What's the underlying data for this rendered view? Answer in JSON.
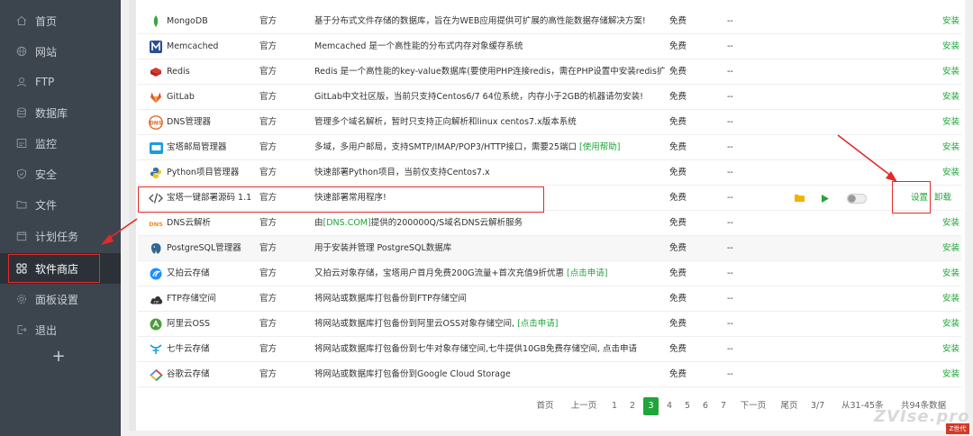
{
  "sidebar": {
    "items": [
      {
        "label": "首页",
        "icon": "home-icon"
      },
      {
        "label": "网站",
        "icon": "globe-icon"
      },
      {
        "label": "FTP",
        "icon": "ftp-icon"
      },
      {
        "label": "数据库",
        "icon": "database-icon"
      },
      {
        "label": "监控",
        "icon": "monitor-icon"
      },
      {
        "label": "安全",
        "icon": "shield-icon"
      },
      {
        "label": "文件",
        "icon": "folder-icon"
      },
      {
        "label": "计划任务",
        "icon": "calendar-icon"
      },
      {
        "label": "软件商店",
        "icon": "grid-icon",
        "active": true
      },
      {
        "label": "面板设置",
        "icon": "gear-icon"
      },
      {
        "label": "退出",
        "icon": "logout-icon"
      }
    ],
    "add_label": "+"
  },
  "plugins": [
    {
      "name": "MongoDB",
      "type": "官方",
      "desc": "基于分布式文件存储的数据库，旨在为WEB应用提供可扩展的高性能数据存储解决方案!",
      "price": "免费",
      "expire": "--",
      "action": "安装",
      "icon": "mongodb-icon",
      "icon_color": "#3aa645"
    },
    {
      "name": "Memcached",
      "type": "官方",
      "desc": "Memcached 是一个高性能的分布式内存对象缓存系统",
      "price": "免费",
      "expire": "--",
      "action": "安装",
      "icon": "memcached-icon",
      "icon_color": "#2a4f8f"
    },
    {
      "name": "Redis",
      "type": "官方",
      "desc": "Redis 是一个高性能的key-value数据库(要使用PHP连接redis，需在PHP设置中安装redis扩展)",
      "price": "免费",
      "expire": "--",
      "action": "安装",
      "icon": "redis-icon",
      "icon_color": "#c8302c"
    },
    {
      "name": "GitLab",
      "type": "官方",
      "desc": "GitLab中文社区版，当前只支持Centos6/7 64位系统，内存小于2GB的机器请勿安装!",
      "price": "免费",
      "expire": "--",
      "action": "安装",
      "icon": "gitlab-icon",
      "icon_color": "#e2572c"
    },
    {
      "name": "DNS管理器",
      "type": "官方",
      "desc": "管理多个域名解析，暂时只支持正向解析和linux centos7.x版本系统",
      "price": "免费",
      "expire": "--",
      "action": "安装",
      "icon": "dns-manager-icon",
      "icon_color": "#e36b2c"
    },
    {
      "name": "宝塔邮局管理器",
      "type": "官方",
      "desc_pre": "多域，多用户邮局，支持SMTP/IMAP/POP3/HTTP接口，需要25端口 ",
      "desc_link": "[使用帮助]",
      "price": "免费",
      "expire": "--",
      "action": "安装",
      "icon": "mail-icon",
      "icon_color": "#1e9be0"
    },
    {
      "name": "Python项目管理器",
      "type": "官方",
      "desc": "快速部署Python项目，当前仅支持Centos7.x",
      "price": "免费",
      "expire": "--",
      "action": "安装",
      "icon": "python-icon",
      "icon_color": "#3572a5"
    },
    {
      "name": "宝塔一键部署源码 1.1",
      "type": "官方",
      "desc": "快速部署常用程序!",
      "price": "免费",
      "expire": "--",
      "settings": "设置",
      "uninstall": "卸载",
      "icon": "code-icon",
      "icon_color": "#555555",
      "installed": true
    },
    {
      "name": "DNS云解析",
      "type": "官方",
      "desc_pre": "由",
      "desc_link": "[DNS.COM]",
      "desc_post": "提供的200000Q/S域名DNS云解析服务",
      "price": "免费",
      "expire": "--",
      "action": "安装",
      "icon": "dns-cloud-icon",
      "icon_color": "#f08a24"
    },
    {
      "name": "PostgreSQL管理器",
      "type": "官方",
      "desc": "用于安装并管理 PostgreSQL数据库",
      "price": "免费",
      "expire": "--",
      "action": "安装",
      "icon": "postgresql-icon",
      "icon_color": "#336791"
    },
    {
      "name": "又拍云存储",
      "type": "官方",
      "desc_pre": "又拍云对象存储，宝塔用户首月免费200G流量+首次充值9折优惠 ",
      "desc_link": "[点击申请]",
      "price": "免费",
      "expire": "--",
      "action": "安装",
      "icon": "upyun-icon",
      "icon_color": "#1e90ff"
    },
    {
      "name": "FTP存储空间",
      "type": "官方",
      "desc": "将网站或数据库打包备份到FTP存储空间",
      "price": "免费",
      "expire": "--",
      "action": "安装",
      "icon": "ftp-storage-icon",
      "icon_color": "#333333"
    },
    {
      "name": "阿里云OSS",
      "type": "官方",
      "desc_pre": "将网站或数据库打包备份到阿里云OSS对象存储空间, ",
      "desc_link": "[点击申请]",
      "price": "免费",
      "expire": "--",
      "action": "安装",
      "icon": "aliyun-oss-icon",
      "icon_color": "#4a9d3a"
    },
    {
      "name": "七牛云存储",
      "type": "官方",
      "desc": "将网站或数据库打包备份到七牛对象存储空间,七牛提供10GB免费存储空间, 点击申请",
      "price": "免费",
      "expire": "--",
      "action": "安装",
      "icon": "qiniu-icon",
      "icon_color": "#1e9be0"
    },
    {
      "name": "谷歌云存储",
      "type": "官方",
      "desc": "将网站或数据库打包备份到Google Cloud Storage",
      "price": "免费",
      "expire": "--",
      "action": "安装",
      "icon": "google-cloud-icon",
      "icon_color": "#4285f4"
    }
  ],
  "pagination": {
    "first": "首页",
    "prev": "上一页",
    "pages": [
      "1",
      "2",
      "3",
      "4",
      "5",
      "6",
      "7"
    ],
    "current": "3",
    "next": "下一页",
    "last": "尾页",
    "page_of": "3/7",
    "range": "从31-45条",
    "total": "共94条数据"
  },
  "watermark": "ZVIse.pro",
  "watermark_badge": "Z世代",
  "colors": {
    "accent": "#20a53a",
    "sidebar": "#3c444d",
    "annotation": "#e32a2a"
  }
}
